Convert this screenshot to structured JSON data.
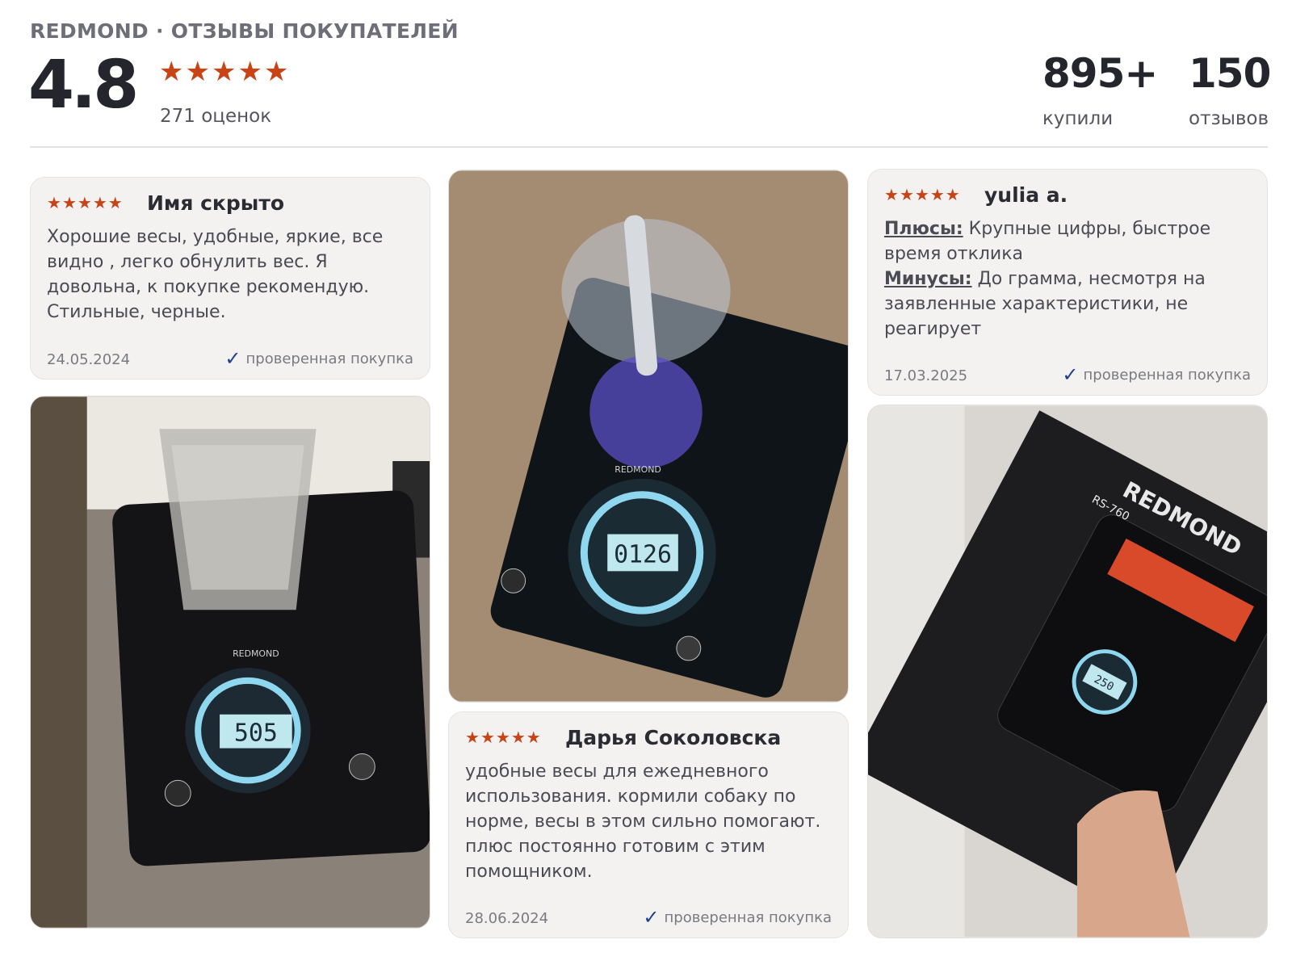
{
  "header": {
    "brand": "REDMOND · ОТЗЫВЫ ПОКУПАТЕЛЕЙ",
    "rating": "4.8",
    "rating_count": "271 оценок",
    "stars_filled": 5,
    "bought_value": "895+",
    "bought_label": "купили",
    "reviews_value": "150",
    "reviews_label": "отзывов"
  },
  "colors": {
    "star": "#c84416",
    "check": "#1f3f8f",
    "card_bg": "#f3f2f0"
  },
  "reviews": [
    {
      "author": "Имя скрыто",
      "stars": 5,
      "text": "Хорошие весы, удобные, яркие, все видно , легко обнулить вес. Я довольна, к покупке рекомендую. Стильные, черные.",
      "date": "24.05.2024",
      "verified": "проверенная покупка"
    },
    {
      "author": "yulia a.",
      "stars": 5,
      "pros_label": "Плюсы:",
      "pros": " Крупные цифры, быстрое время отклика",
      "cons_label": "Минусы:",
      "cons": " До грамма, несмотря на заявленные характеристики, не реагирует",
      "date": "17.03.2025",
      "verified": "проверенная покупка"
    },
    {
      "author": "Дарья Соколовска",
      "stars": 5,
      "text": "удобные весы для ежедневного использования. кормили собаку по норме, весы в этом сильно помогают. плюс постоянно готовим с этим помощником.",
      "date": "28.06.2024",
      "verified": "проверенная покупка"
    }
  ],
  "photos": [
    {
      "brand_mark": "REDMOND",
      "display": "505"
    },
    {
      "brand_mark": "REDMOND",
      "display": "0126"
    },
    {
      "brand_mark": "REDMOND",
      "model": "RS-760",
      "display": "250"
    }
  ]
}
